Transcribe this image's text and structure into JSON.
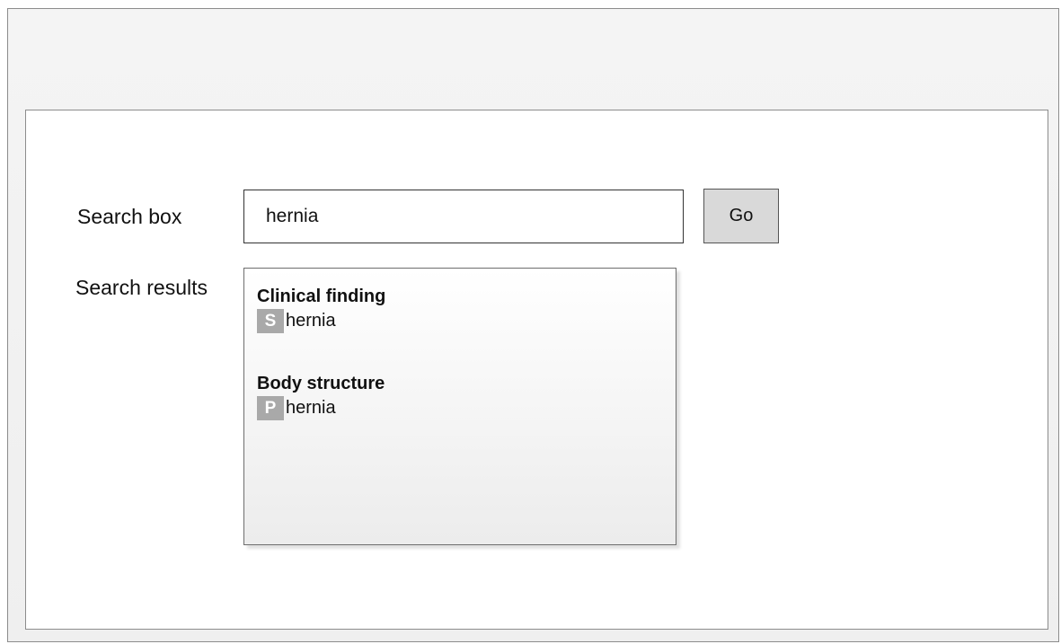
{
  "labels": {
    "search": "Search box",
    "results": "Search results"
  },
  "search": {
    "value": "hernia",
    "go_label": "Go"
  },
  "results": {
    "groups": [
      {
        "heading": "Clinical finding",
        "items": [
          {
            "badge": "S",
            "text": "hernia"
          }
        ]
      },
      {
        "heading": "Body structure",
        "items": [
          {
            "badge": "P",
            "text": "hernia"
          }
        ]
      }
    ]
  },
  "colors": {
    "badge_bg": "#a9a9a9",
    "button_bg": "#d9d9d9",
    "window_bg": "#f0f0f0"
  }
}
